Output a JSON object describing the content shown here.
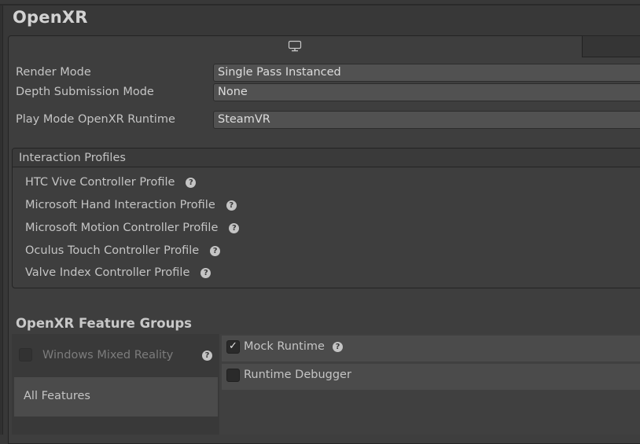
{
  "title": "OpenXR",
  "platform_tabs": [
    {
      "icon": "monitor-icon",
      "label": "Standalone",
      "active": true
    },
    {
      "icon": "",
      "label": "",
      "active": false
    }
  ],
  "settings": {
    "render_mode": {
      "label": "Render Mode",
      "value": "Single Pass Instanced"
    },
    "depth_submission_mode": {
      "label": "Depth Submission Mode",
      "value": "None"
    },
    "play_mode_runtime": {
      "label": "Play Mode OpenXR Runtime",
      "value": "SteamVR"
    }
  },
  "interaction_profiles": {
    "header": "Interaction Profiles",
    "items": [
      {
        "label": "HTC Vive Controller Profile",
        "help": "?"
      },
      {
        "label": "Microsoft Hand Interaction Profile",
        "help": "?"
      },
      {
        "label": "Microsoft Motion Controller Profile",
        "help": "?"
      },
      {
        "label": "Oculus Touch Controller Profile",
        "help": "?"
      },
      {
        "label": "Valve Index Controller Profile",
        "help": "?"
      }
    ]
  },
  "feature_groups": {
    "title": "OpenXR Feature Groups",
    "groups": [
      {
        "label": "Windows Mixed Reality",
        "checked": false,
        "enabled": false,
        "help": "?"
      },
      {
        "label": "All Features",
        "selected": true
      }
    ],
    "features": [
      {
        "label": "Mock Runtime",
        "checked": true,
        "check_glyph": "✓",
        "help": "?"
      },
      {
        "label": "Runtime Debugger",
        "checked": false
      }
    ]
  }
}
